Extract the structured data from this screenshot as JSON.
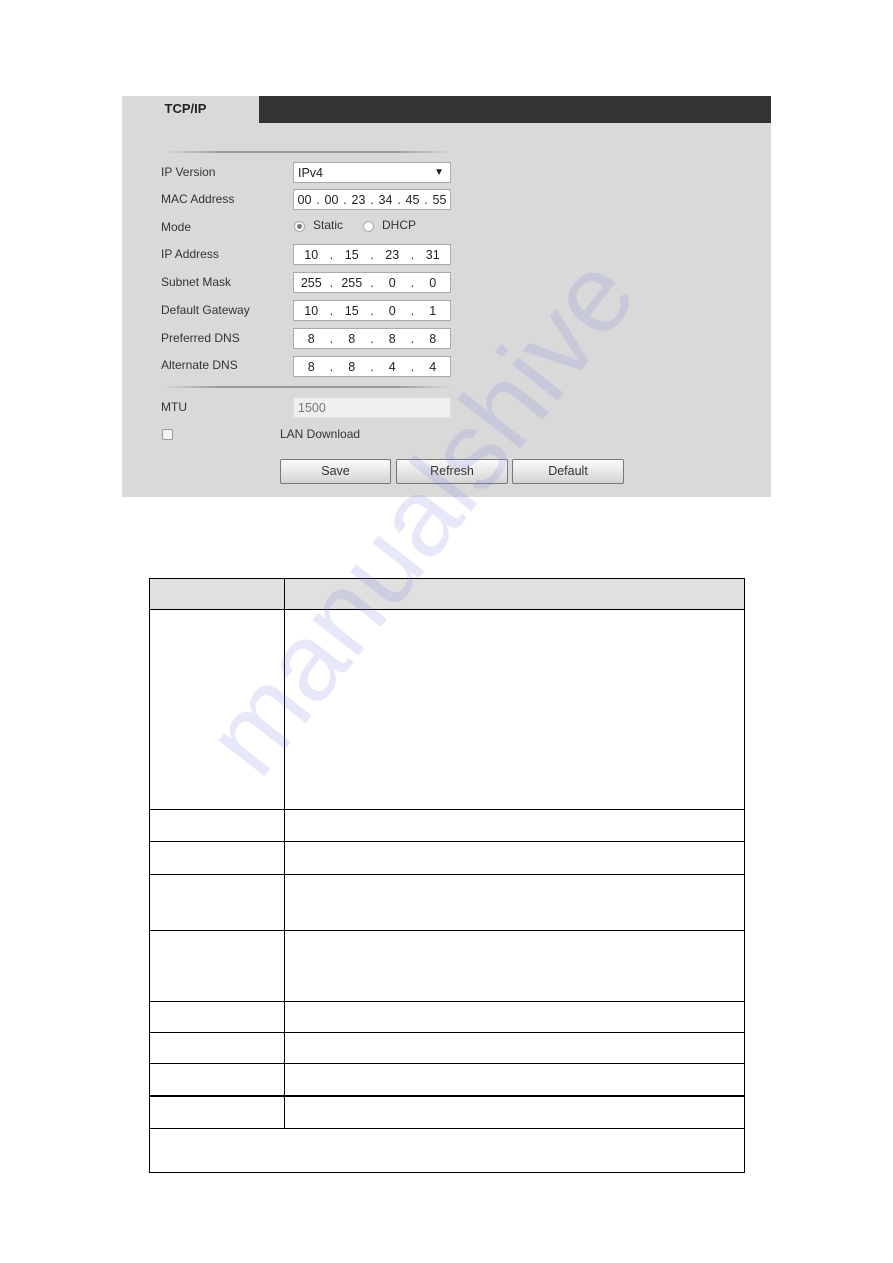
{
  "tab": {
    "title": "TCP/IP"
  },
  "form": {
    "ip_version": {
      "label": "IP Version",
      "value": "IPv4"
    },
    "mac_address": {
      "label": "MAC Address",
      "octets": [
        "00",
        "00",
        "23",
        "34",
        "45",
        "55"
      ]
    },
    "mode": {
      "label": "Mode",
      "options": [
        "Static",
        "DHCP"
      ],
      "selected": "Static"
    },
    "ip_address": {
      "label": "IP Address",
      "octets": [
        "10",
        "15",
        "23",
        "31"
      ]
    },
    "subnet_mask": {
      "label": "Subnet Mask",
      "octets": [
        "255",
        "255",
        "0",
        "0"
      ]
    },
    "default_gateway": {
      "label": "Default Gateway",
      "octets": [
        "10",
        "15",
        "0",
        "1"
      ]
    },
    "preferred_dns": {
      "label": "Preferred DNS",
      "octets": [
        "8",
        "8",
        "8",
        "8"
      ]
    },
    "alternate_dns": {
      "label": "Alternate DNS",
      "octets": [
        "8",
        "8",
        "4",
        "4"
      ]
    },
    "mtu": {
      "label": "MTU",
      "value": "1500"
    },
    "lan_download": {
      "label": "LAN Download",
      "checked": false
    }
  },
  "buttons": {
    "save": "Save",
    "refresh": "Refresh",
    "default": "Default"
  },
  "watermark": "manualshive"
}
